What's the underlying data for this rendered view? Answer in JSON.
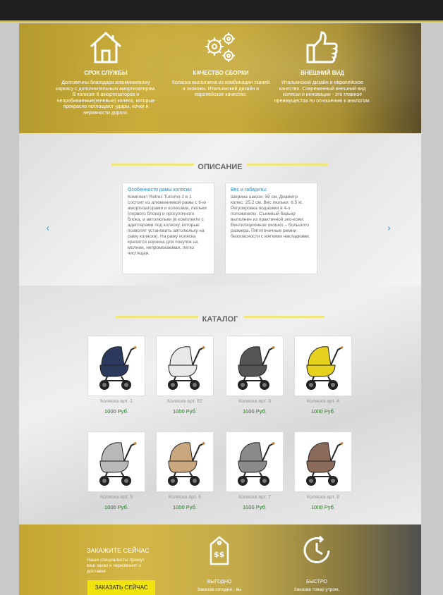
{
  "features": [
    {
      "icon": "house-icon",
      "title": "СРОК СЛУЖБЫ",
      "text": "Долговечны благодаря алюминиевому каркасу с дополнительным амортизатором. В коляске 6 амортизаторов и непробиваемые(гелевые) колеса, которые прекрасно поглощают удары, кочки и неровности дороги."
    },
    {
      "icon": "gears-icon",
      "title": "КАЧЕСТВО СБОРКИ",
      "text": "Коляска выполнена из комбинации тканей и экокожи. Итальянский дизайн и европейское качество."
    },
    {
      "icon": "thumbs-up-icon",
      "title": "ВНЕШНИЙ ВИД",
      "text": "Итальянский дизайн и европейское качество. Современный внешний вид коляски и инновации - это главное преимущества по отношению к аналогам."
    }
  ],
  "description": {
    "title": "ОПИСАНИЕ",
    "cards": [
      {
        "heading": "Особенности рамы коляски:",
        "text": "Комплект Retrus Turismo 2 в 1 состоит из алюминиевой рамы с 6-ю амортизаторами и колесами, люльки (первого блока) и прогулочного блока, и автолюльки (в комплекте с адептерами под коляску, которые позволят установить автолюльку на раму коляски). На раму коляска крепится корзина для покупок на молнии, непромокаемая, легко чистящая."
      },
      {
        "heading": "Вес и габариты:",
        "text": "Ширина шасси: 59 см. Диаметр колес: 25,2 см. Вес люльки: 6.5 кг. Регулировка подножки в 4-х положениях. Съемный барьер выполнен из практичной эко-кожи. Вентиляционное окошко – большого размера. Пятиточечные ремни безопасности с мягкими накладками."
      }
    ],
    "prev_arrow": "‹",
    "next_arrow": "›"
  },
  "catalog": {
    "title": "КАТАЛОГ",
    "products": [
      {
        "name": "Коляска арт. 1",
        "price": "1000 Руб.",
        "color": "#2b3a5c"
      },
      {
        "name": "Коляска арт. 82",
        "price": "1000 Руб.",
        "color": "#e8e8e8"
      },
      {
        "name": "Коляска арт. 3",
        "price": "1000 Руб.",
        "color": "#555555"
      },
      {
        "name": "Коляска арт. 4",
        "price": "1000 Руб.",
        "color": "#e6d21e"
      },
      {
        "name": "Коляска арт. 5",
        "price": "1000 Руб.",
        "color": "#b8b8b8"
      },
      {
        "name": "Коляска арт. 6",
        "price": "1000 Руб.",
        "color": "#c9a880"
      },
      {
        "name": "Коляска арт. 7",
        "price": "1000 Руб.",
        "color": "#8a8a8a"
      },
      {
        "name": "Коляска арт. 8",
        "price": "1000 Руб.",
        "color": "#8a6a58"
      }
    ]
  },
  "order": {
    "title": "ЗАКАЖИТЕ СЕЙЧАС",
    "subtitle": "Наши специалисты примут ваш заказ и перезвонят о доставке",
    "button": "ЗАКАЗАТЬ СЕЙЧАС",
    "features": [
      {
        "icon": "price-tag-icon",
        "title": "ВЫГОДНО",
        "text": "Заказав сегодня , вы"
      },
      {
        "icon": "clock-icon",
        "title": "БЫСТРО",
        "text": "Заказав товар утром,"
      }
    ]
  }
}
